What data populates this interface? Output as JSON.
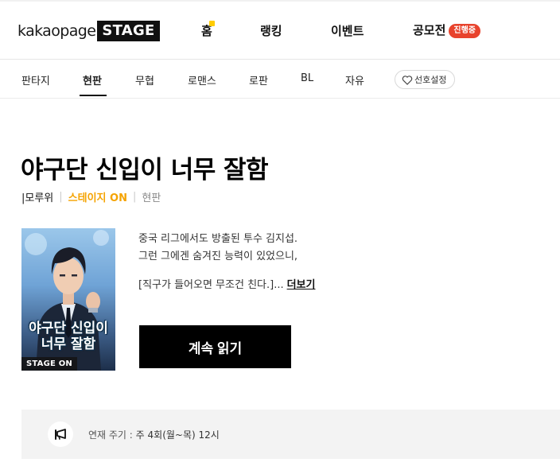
{
  "header": {
    "logo_text": "kakaopage",
    "logo_badge": "STAGE",
    "nav": [
      {
        "label": "홈"
      },
      {
        "label": "랭킹"
      },
      {
        "label": "이벤트"
      },
      {
        "label": "공모전",
        "badge": "진행중"
      }
    ]
  },
  "genres": {
    "tabs": [
      "판타지",
      "현판",
      "무협",
      "로맨스",
      "로판",
      "BL",
      "자유"
    ],
    "active": "현판",
    "pref_label": "선호설정"
  },
  "work": {
    "title": "야구단 신입이 너무 잘함",
    "author": "|모루위",
    "stage_tag": "스테이지 ON",
    "genre": "현판",
    "cover": {
      "title_line1": "야구단 신입이",
      "title_line2": "너무 잘함",
      "badge": "STAGE ON"
    },
    "description": [
      "중국 리그에서도 방출된 투수 김지섭.",
      "그런 그에겐 숨겨진 능력이 있었으니,"
    ],
    "teaser": "[직구가 들어오면 무조건 친다.]...",
    "more_label": "더보기",
    "read_label": "계속 읽기"
  },
  "schedule": {
    "label": "연재 주기 :",
    "value": "주 4회(월~목) 12시"
  },
  "colors": {
    "accent": "#f5a300",
    "contest_badge": "#e8432d",
    "home_dot": "#ffcc00"
  }
}
